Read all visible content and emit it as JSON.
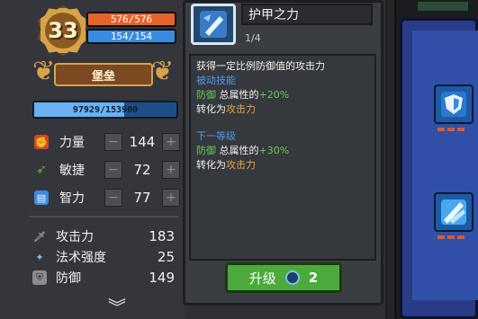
{
  "character": {
    "level": "33",
    "hp": "576/576",
    "mp": "154/154",
    "title": "堡垒",
    "xp": "97929/153900",
    "xp_fraction": 0.636
  },
  "stats": [
    {
      "label": "力量",
      "value": "144",
      "icon": "fist-icon",
      "color": "#d8462a"
    },
    {
      "label": "敏捷",
      "value": "72",
      "icon": "feather-icon",
      "color": "#5cb83c"
    },
    {
      "label": "智力",
      "value": "77",
      "icon": "book-icon",
      "color": "#3a8be0"
    }
  ],
  "attributes": [
    {
      "label": "攻击力",
      "value": "183",
      "icon": "sword-icon"
    },
    {
      "label": "法术强度",
      "value": "25",
      "icon": "wand-icon"
    },
    {
      "label": "防御",
      "value": "149",
      "icon": "shield-icon"
    }
  ],
  "skill": {
    "name": "护甲之力",
    "level": "1/4",
    "desc_line1": "获得一定比例防御值的攻击力",
    "passive_label": "被动技能",
    "current_prefix": "防御",
    "current_mid": "总属性的",
    "current_pct": "+20%",
    "convert_prefix": "转化为",
    "convert_target": "攻击力",
    "next_label": "下一等级",
    "next_prefix": "防御",
    "next_mid": "总属性的",
    "next_pct": "+30%",
    "next_convert_prefix": "转化为",
    "next_convert_target": "攻击力"
  },
  "upgrade": {
    "label": "升级",
    "cost": "2",
    "cost_icon": "skill-point-icon"
  },
  "colors": {
    "hp": "#e8632a",
    "mp": "#3a8be0",
    "upgrade": "#4caa3c",
    "passive_text": "#4e9ae8",
    "stat_text": "#6cc85c",
    "highlight_text": "#e8a442"
  }
}
